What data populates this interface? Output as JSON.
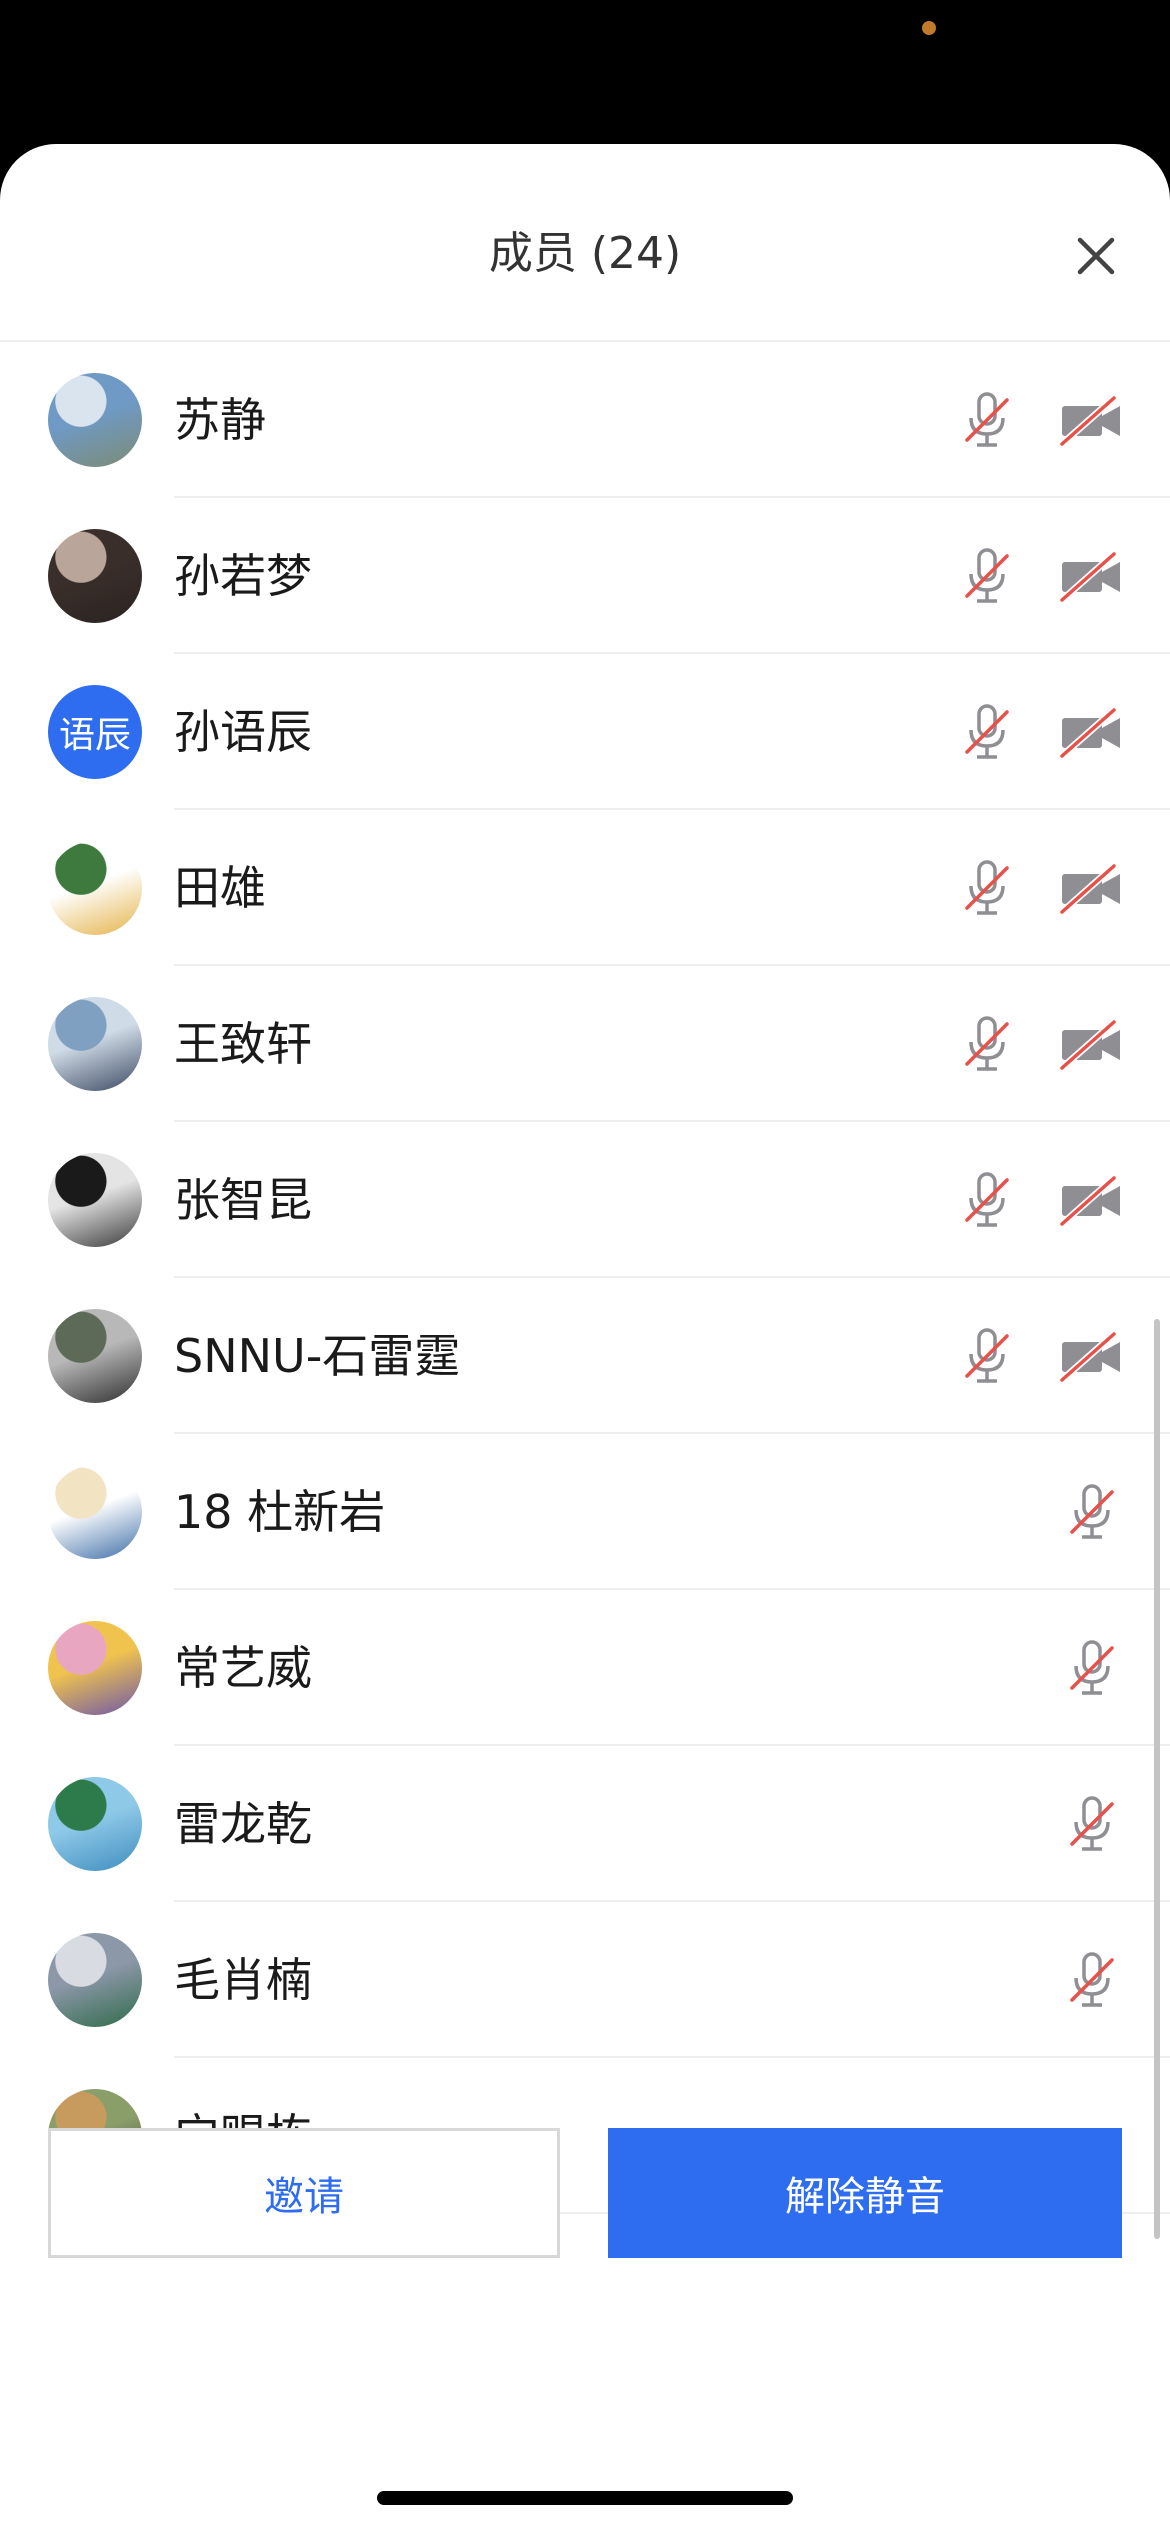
{
  "header": {
    "title": "成员 (24)"
  },
  "members": [
    {
      "name": "苏静",
      "avatar": {
        "type": "image",
        "colors": [
          "#6f9ac6",
          "#d9e4ee",
          "#7c8b74"
        ]
      },
      "mic_muted": true,
      "camera_off": true
    },
    {
      "name": "孙若梦",
      "avatar": {
        "type": "image",
        "colors": [
          "#3a2e2a",
          "#b9a59a",
          "#2a2422"
        ]
      },
      "mic_muted": true,
      "camera_off": true
    },
    {
      "name": "孙语辰",
      "avatar": {
        "type": "text",
        "text": "语辰"
      },
      "mic_muted": true,
      "camera_off": true
    },
    {
      "name": "田雄",
      "avatar": {
        "type": "image",
        "colors": [
          "#ffffff",
          "#3e7a3d",
          "#e4b34a"
        ]
      },
      "mic_muted": true,
      "camera_off": true
    },
    {
      "name": "王致轩",
      "avatar": {
        "type": "image",
        "colors": [
          "#cfdbe6",
          "#7fa0c0",
          "#3c4a63"
        ]
      },
      "mic_muted": true,
      "camera_off": true
    },
    {
      "name": "张智昆",
      "avatar": {
        "type": "image",
        "colors": [
          "#e4e4e4",
          "#1a1a1a",
          "#3a3a3a"
        ]
      },
      "mic_muted": true,
      "camera_off": true
    },
    {
      "name": "SNNU-石雷霆",
      "avatar": {
        "type": "image",
        "colors": [
          "#b8b8b8",
          "#5d6a58",
          "#2f2f2f"
        ]
      },
      "mic_muted": true,
      "camera_off": true
    },
    {
      "name": "18 杜新岩",
      "avatar": {
        "type": "image",
        "colors": [
          "#ffffff",
          "#f2e3c2",
          "#3e6ea8"
        ]
      },
      "mic_muted": true,
      "camera_off": null
    },
    {
      "name": "常艺威",
      "avatar": {
        "type": "image",
        "colors": [
          "#f0c34e",
          "#e9a6c0",
          "#6d56a8"
        ]
      },
      "mic_muted": true,
      "camera_off": null
    },
    {
      "name": "雷龙乾",
      "avatar": {
        "type": "image",
        "colors": [
          "#8fc9e8",
          "#2d7a4a",
          "#3f8ebf"
        ]
      },
      "mic_muted": true,
      "camera_off": null
    },
    {
      "name": "毛肖楠",
      "avatar": {
        "type": "image",
        "colors": [
          "#8c97a8",
          "#d8dbe2",
          "#2f6b4a"
        ]
      },
      "mic_muted": true,
      "camera_off": null
    },
    {
      "name": "宁赐栋",
      "avatar": {
        "type": "image",
        "colors": [
          "#8a9e6a",
          "#c79a5e",
          "#4a4a40"
        ]
      },
      "mic_muted": null,
      "camera_off": null
    }
  ],
  "actions": {
    "invite": "邀请",
    "unmute_all": "解除静音"
  },
  "colors": {
    "accent": "#2e6cf0",
    "muted_slash": "#e8504a",
    "icon_gray": "#8e8e93"
  },
  "icons": {
    "close": "close-icon",
    "mic_off": "mic-off-icon",
    "camera_off": "camera-off-icon"
  }
}
